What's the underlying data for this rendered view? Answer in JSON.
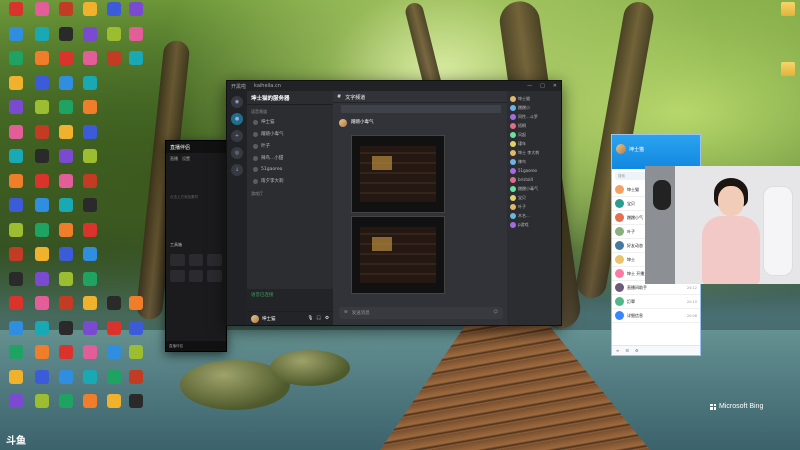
{
  "desktop": {
    "watermark": "Microsoft Bing",
    "corner_logo": "斗鱼",
    "right_folders": [
      {
        "label": ""
      },
      {
        "label": ""
      }
    ]
  },
  "main_window": {
    "title_left": "开黑啦",
    "title_mid": "kaiheila.cn",
    "server_name": "坤士猫的服务器",
    "channels": [
      {
        "name": "坤士猫"
      },
      {
        "name": "蹭蹭小毒气"
      },
      {
        "name": "叶子"
      },
      {
        "name": "辣鸟...小甜"
      },
      {
        "name": "51gaoreo"
      },
      {
        "name": "雨夕李大刺"
      }
    ],
    "category_1": "语音频道",
    "category_2": "游戏厅",
    "voice_status": "语音已连接",
    "user_name": "坤士猫",
    "chat_channel": "文字频道",
    "message_author": "蹭蹭小毒气",
    "input_placeholder": "发送消息",
    "members": [
      {
        "name": "坤士猫"
      },
      {
        "name": "蹭蹭小"
      },
      {
        "name": "同性...斗罗"
      },
      {
        "name": "梧桐"
      },
      {
        "name": "风起"
      },
      {
        "name": "瑾年"
      },
      {
        "name": "坤士 李大刺"
      },
      {
        "name": "辣鸟"
      },
      {
        "name": "51gaoreo"
      },
      {
        "name": "bristol4"
      },
      {
        "name": "蹭蹭小毒气"
      },
      {
        "name": "宝贝"
      },
      {
        "name": "叶子"
      },
      {
        "name": "木名..."
      },
      {
        "name": "p游戏"
      }
    ]
  },
  "stream_window": {
    "title": "直播伴侣",
    "tab_1": "直播",
    "tab_2": "设置",
    "placeholder": "点击上方添加素材",
    "section_label": "工具箱",
    "footer": "直播伴侣"
  },
  "qq_window": {
    "profile_name": "坤士猫",
    "search_placeholder": "搜索",
    "contacts": [
      {
        "name": "坤士猫",
        "time": ""
      },
      {
        "name": "宝贝",
        "time": ""
      },
      {
        "name": "蹭蹭小气",
        "time": ""
      },
      {
        "name": "叶子",
        "time": ""
      },
      {
        "name": "好友动态",
        "time": ""
      },
      {
        "name": "坤士",
        "time": "20:18"
      },
      {
        "name": "坤士 开播大神",
        "time": "20:16"
      },
      {
        "name": "直播间助手",
        "time": "20:12"
      },
      {
        "name": "訂單",
        "time": "20:10"
      },
      {
        "name": "详细信息",
        "time": "20:08"
      }
    ]
  }
}
